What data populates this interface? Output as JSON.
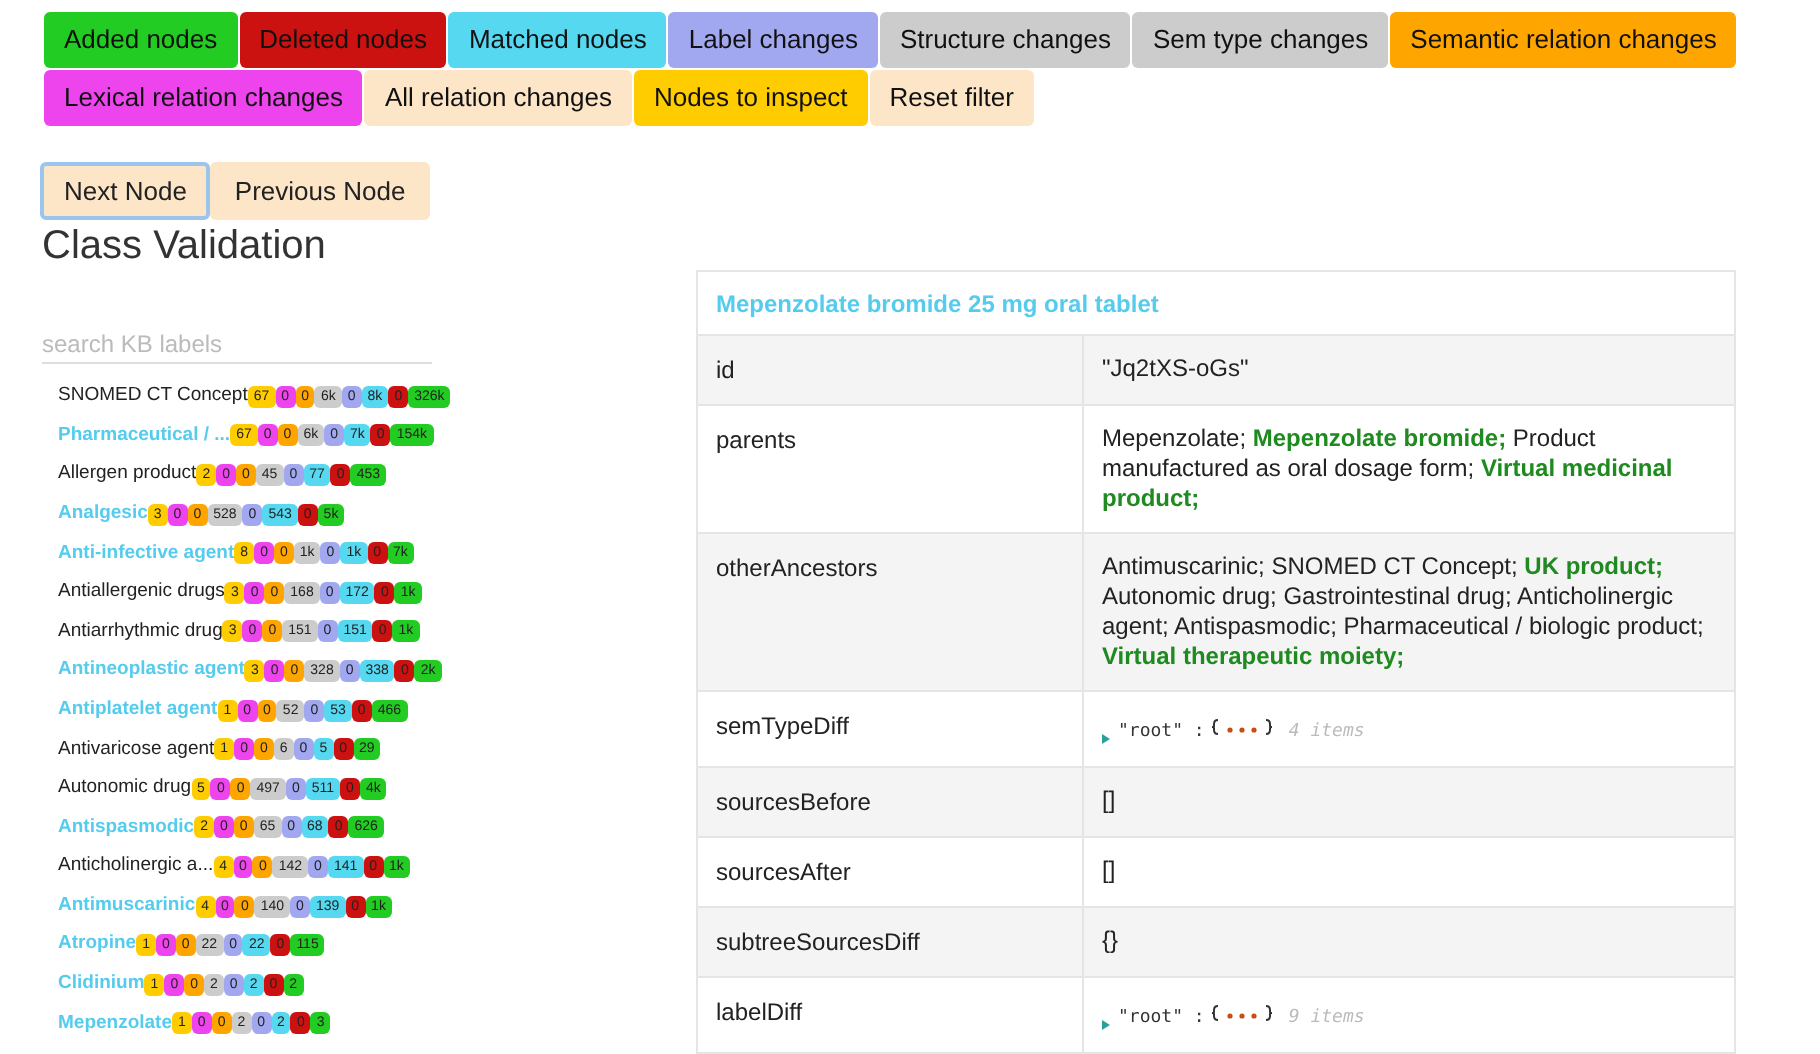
{
  "filters": [
    {
      "label": "Added nodes",
      "color": "#22cc22"
    },
    {
      "label": "Deleted nodes",
      "color": "#cc1111"
    },
    {
      "label": "Matched nodes",
      "color": "#55d8f0"
    },
    {
      "label": "Label changes",
      "color": "#a2a8f0"
    },
    {
      "label": "Structure changes",
      "color": "#cccccc"
    },
    {
      "label": "Sem type changes",
      "color": "#cccccc"
    },
    {
      "label": "Semantic relation changes",
      "color": "#ffa500"
    },
    {
      "label": "Lexical relation changes",
      "color": "#ee44ee"
    },
    {
      "label": "All relation changes",
      "color": "#fde5c7"
    },
    {
      "label": "Nodes to inspect",
      "color": "#ffcc00"
    },
    {
      "label": "Reset filter",
      "color": "#fde5c7"
    }
  ],
  "nav_buttons": [
    {
      "label": "Next Node",
      "selected": true
    },
    {
      "label": "Previous Node",
      "selected": false
    }
  ],
  "heading": "Class Validation",
  "search": {
    "placeholder": "search KB labels"
  },
  "nodes": [
    {
      "label": "SNOMED CT Concept",
      "highlighted": false,
      "counts": [
        {
          "text": "67",
          "color": "#ffcc00"
        },
        {
          "text": "0",
          "color": "#ee44ee"
        },
        {
          "text": "0",
          "color": "#ffa500"
        },
        {
          "text": "6k",
          "color": "#cccccc"
        },
        {
          "text": "0",
          "color": "#a2a8f0"
        },
        {
          "text": "8k",
          "color": "#55d8f0"
        },
        {
          "text": "0",
          "color": "#cc1111"
        },
        {
          "text": "326k",
          "color": "#22cc22"
        }
      ]
    },
    {
      "label": "Pharmaceutical / ...",
      "highlighted": true,
      "counts": [
        {
          "text": "67",
          "color": "#ffcc00"
        },
        {
          "text": "0",
          "color": "#ee44ee"
        },
        {
          "text": "0",
          "color": "#ffa500"
        },
        {
          "text": "6k",
          "color": "#cccccc"
        },
        {
          "text": "0",
          "color": "#a2a8f0"
        },
        {
          "text": "7k",
          "color": "#55d8f0"
        },
        {
          "text": "0",
          "color": "#cc1111"
        },
        {
          "text": "154k",
          "color": "#22cc22"
        }
      ]
    },
    {
      "label": "Allergen product",
      "highlighted": false,
      "counts": [
        {
          "text": "2",
          "color": "#ffcc00"
        },
        {
          "text": "0",
          "color": "#ee44ee"
        },
        {
          "text": "0",
          "color": "#ffa500"
        },
        {
          "text": "45",
          "color": "#cccccc"
        },
        {
          "text": "0",
          "color": "#a2a8f0"
        },
        {
          "text": "77",
          "color": "#55d8f0"
        },
        {
          "text": "0",
          "color": "#cc1111"
        },
        {
          "text": "453",
          "color": "#22cc22"
        }
      ]
    },
    {
      "label": "Analgesic",
      "highlighted": true,
      "counts": [
        {
          "text": "3",
          "color": "#ffcc00"
        },
        {
          "text": "0",
          "color": "#ee44ee"
        },
        {
          "text": "0",
          "color": "#ffa500"
        },
        {
          "text": "528",
          "color": "#cccccc"
        },
        {
          "text": "0",
          "color": "#a2a8f0"
        },
        {
          "text": "543",
          "color": "#55d8f0"
        },
        {
          "text": "0",
          "color": "#cc1111"
        },
        {
          "text": "5k",
          "color": "#22cc22"
        }
      ]
    },
    {
      "label": "Anti-infective agent",
      "highlighted": true,
      "counts": [
        {
          "text": "8",
          "color": "#ffcc00"
        },
        {
          "text": "0",
          "color": "#ee44ee"
        },
        {
          "text": "0",
          "color": "#ffa500"
        },
        {
          "text": "1k",
          "color": "#cccccc"
        },
        {
          "text": "0",
          "color": "#a2a8f0"
        },
        {
          "text": "1k",
          "color": "#55d8f0"
        },
        {
          "text": "0",
          "color": "#cc1111"
        },
        {
          "text": "7k",
          "color": "#22cc22"
        }
      ]
    },
    {
      "label": "Antiallergenic drugs",
      "highlighted": false,
      "counts": [
        {
          "text": "3",
          "color": "#ffcc00"
        },
        {
          "text": "0",
          "color": "#ee44ee"
        },
        {
          "text": "0",
          "color": "#ffa500"
        },
        {
          "text": "168",
          "color": "#cccccc"
        },
        {
          "text": "0",
          "color": "#a2a8f0"
        },
        {
          "text": "172",
          "color": "#55d8f0"
        },
        {
          "text": "0",
          "color": "#cc1111"
        },
        {
          "text": "1k",
          "color": "#22cc22"
        }
      ]
    },
    {
      "label": "Antiarrhythmic drug",
      "highlighted": false,
      "counts": [
        {
          "text": "3",
          "color": "#ffcc00"
        },
        {
          "text": "0",
          "color": "#ee44ee"
        },
        {
          "text": "0",
          "color": "#ffa500"
        },
        {
          "text": "151",
          "color": "#cccccc"
        },
        {
          "text": "0",
          "color": "#a2a8f0"
        },
        {
          "text": "151",
          "color": "#55d8f0"
        },
        {
          "text": "0",
          "color": "#cc1111"
        },
        {
          "text": "1k",
          "color": "#22cc22"
        }
      ]
    },
    {
      "label": "Antineoplastic agent",
      "highlighted": true,
      "counts": [
        {
          "text": "3",
          "color": "#ffcc00"
        },
        {
          "text": "0",
          "color": "#ee44ee"
        },
        {
          "text": "0",
          "color": "#ffa500"
        },
        {
          "text": "328",
          "color": "#cccccc"
        },
        {
          "text": "0",
          "color": "#a2a8f0"
        },
        {
          "text": "338",
          "color": "#55d8f0"
        },
        {
          "text": "0",
          "color": "#cc1111"
        },
        {
          "text": "2k",
          "color": "#22cc22"
        }
      ]
    },
    {
      "label": "Antiplatelet agent",
      "highlighted": true,
      "counts": [
        {
          "text": "1",
          "color": "#ffcc00"
        },
        {
          "text": "0",
          "color": "#ee44ee"
        },
        {
          "text": "0",
          "color": "#ffa500"
        },
        {
          "text": "52",
          "color": "#cccccc"
        },
        {
          "text": "0",
          "color": "#a2a8f0"
        },
        {
          "text": "53",
          "color": "#55d8f0"
        },
        {
          "text": "0",
          "color": "#cc1111"
        },
        {
          "text": "466",
          "color": "#22cc22"
        }
      ]
    },
    {
      "label": "Antivaricose agent",
      "highlighted": false,
      "counts": [
        {
          "text": "1",
          "color": "#ffcc00"
        },
        {
          "text": "0",
          "color": "#ee44ee"
        },
        {
          "text": "0",
          "color": "#ffa500"
        },
        {
          "text": "6",
          "color": "#cccccc"
        },
        {
          "text": "0",
          "color": "#a2a8f0"
        },
        {
          "text": "5",
          "color": "#55d8f0"
        },
        {
          "text": "0",
          "color": "#cc1111"
        },
        {
          "text": "29",
          "color": "#22cc22"
        }
      ]
    },
    {
      "label": "Autonomic drug",
      "highlighted": false,
      "counts": [
        {
          "text": "5",
          "color": "#ffcc00"
        },
        {
          "text": "0",
          "color": "#ee44ee"
        },
        {
          "text": "0",
          "color": "#ffa500"
        },
        {
          "text": "497",
          "color": "#cccccc"
        },
        {
          "text": "0",
          "color": "#a2a8f0"
        },
        {
          "text": "511",
          "color": "#55d8f0"
        },
        {
          "text": "0",
          "color": "#cc1111"
        },
        {
          "text": "4k",
          "color": "#22cc22"
        }
      ]
    },
    {
      "label": "Antispasmodic",
      "highlighted": true,
      "counts": [
        {
          "text": "2",
          "color": "#ffcc00"
        },
        {
          "text": "0",
          "color": "#ee44ee"
        },
        {
          "text": "0",
          "color": "#ffa500"
        },
        {
          "text": "65",
          "color": "#cccccc"
        },
        {
          "text": "0",
          "color": "#a2a8f0"
        },
        {
          "text": "68",
          "color": "#55d8f0"
        },
        {
          "text": "0",
          "color": "#cc1111"
        },
        {
          "text": "626",
          "color": "#22cc22"
        }
      ]
    },
    {
      "label": "Anticholinergic a...",
      "highlighted": false,
      "counts": [
        {
          "text": "4",
          "color": "#ffcc00"
        },
        {
          "text": "0",
          "color": "#ee44ee"
        },
        {
          "text": "0",
          "color": "#ffa500"
        },
        {
          "text": "142",
          "color": "#cccccc"
        },
        {
          "text": "0",
          "color": "#a2a8f0"
        },
        {
          "text": "141",
          "color": "#55d8f0"
        },
        {
          "text": "0",
          "color": "#cc1111"
        },
        {
          "text": "1k",
          "color": "#22cc22"
        }
      ]
    },
    {
      "label": "Antimuscarinic",
      "highlighted": true,
      "counts": [
        {
          "text": "4",
          "color": "#ffcc00"
        },
        {
          "text": "0",
          "color": "#ee44ee"
        },
        {
          "text": "0",
          "color": "#ffa500"
        },
        {
          "text": "140",
          "color": "#cccccc"
        },
        {
          "text": "0",
          "color": "#a2a8f0"
        },
        {
          "text": "139",
          "color": "#55d8f0"
        },
        {
          "text": "0",
          "color": "#cc1111"
        },
        {
          "text": "1k",
          "color": "#22cc22"
        }
      ]
    },
    {
      "label": "Atropine",
      "highlighted": true,
      "counts": [
        {
          "text": "1",
          "color": "#ffcc00"
        },
        {
          "text": "0",
          "color": "#ee44ee"
        },
        {
          "text": "0",
          "color": "#ffa500"
        },
        {
          "text": "22",
          "color": "#cccccc"
        },
        {
          "text": "0",
          "color": "#a2a8f0"
        },
        {
          "text": "22",
          "color": "#55d8f0"
        },
        {
          "text": "0",
          "color": "#cc1111"
        },
        {
          "text": "115",
          "color": "#22cc22"
        }
      ]
    },
    {
      "label": "Clidinium",
      "highlighted": true,
      "counts": [
        {
          "text": "1",
          "color": "#ffcc00"
        },
        {
          "text": "0",
          "color": "#ee44ee"
        },
        {
          "text": "0",
          "color": "#ffa500"
        },
        {
          "text": "2",
          "color": "#cccccc"
        },
        {
          "text": "0",
          "color": "#a2a8f0"
        },
        {
          "text": "2",
          "color": "#55d8f0"
        },
        {
          "text": "0",
          "color": "#cc1111"
        },
        {
          "text": "2",
          "color": "#22cc22"
        }
      ]
    },
    {
      "label": "Mepenzolate",
      "highlighted": true,
      "counts": [
        {
          "text": "1",
          "color": "#ffcc00"
        },
        {
          "text": "0",
          "color": "#ee44ee"
        },
        {
          "text": "0",
          "color": "#ffa500"
        },
        {
          "text": "2",
          "color": "#cccccc"
        },
        {
          "text": "0",
          "color": "#a2a8f0"
        },
        {
          "text": "2",
          "color": "#55d8f0"
        },
        {
          "text": "0",
          "color": "#cc1111"
        },
        {
          "text": "3",
          "color": "#22cc22"
        }
      ]
    }
  ],
  "detail": {
    "title": "Mepenzolate bromide 25 mg oral tablet",
    "rows": [
      {
        "key": "id",
        "kind": "text",
        "value": "\"Jq2tXS-oGs\""
      },
      {
        "key": "parents",
        "kind": "text",
        "value": "Mepenzolate; **Mepenzolate bromide;** Product manufactured as oral dosage form; **Virtual medicinal product;**"
      },
      {
        "key": "otherAncestors",
        "kind": "text",
        "value": "Antimuscarinic; SNOMED CT Concept; **UK product;** Autonomic drug; Gastrointestinal drug; Anticholinergic agent; Antispasmodic; Pharmaceutical / biologic product; **Virtual therapeutic moiety;**"
      },
      {
        "key": "semTypeDiff",
        "kind": "json",
        "value": "\"root\" :",
        "summary": "4 items"
      },
      {
        "key": "sourcesBefore",
        "kind": "text",
        "value": "[]"
      },
      {
        "key": "sourcesAfter",
        "kind": "text",
        "value": "[]"
      },
      {
        "key": "subtreeSourcesDiff",
        "kind": "text",
        "value": "{}"
      },
      {
        "key": "labelDiff",
        "kind": "json",
        "value": "\"root\" :",
        "summary": "9 items"
      }
    ]
  }
}
